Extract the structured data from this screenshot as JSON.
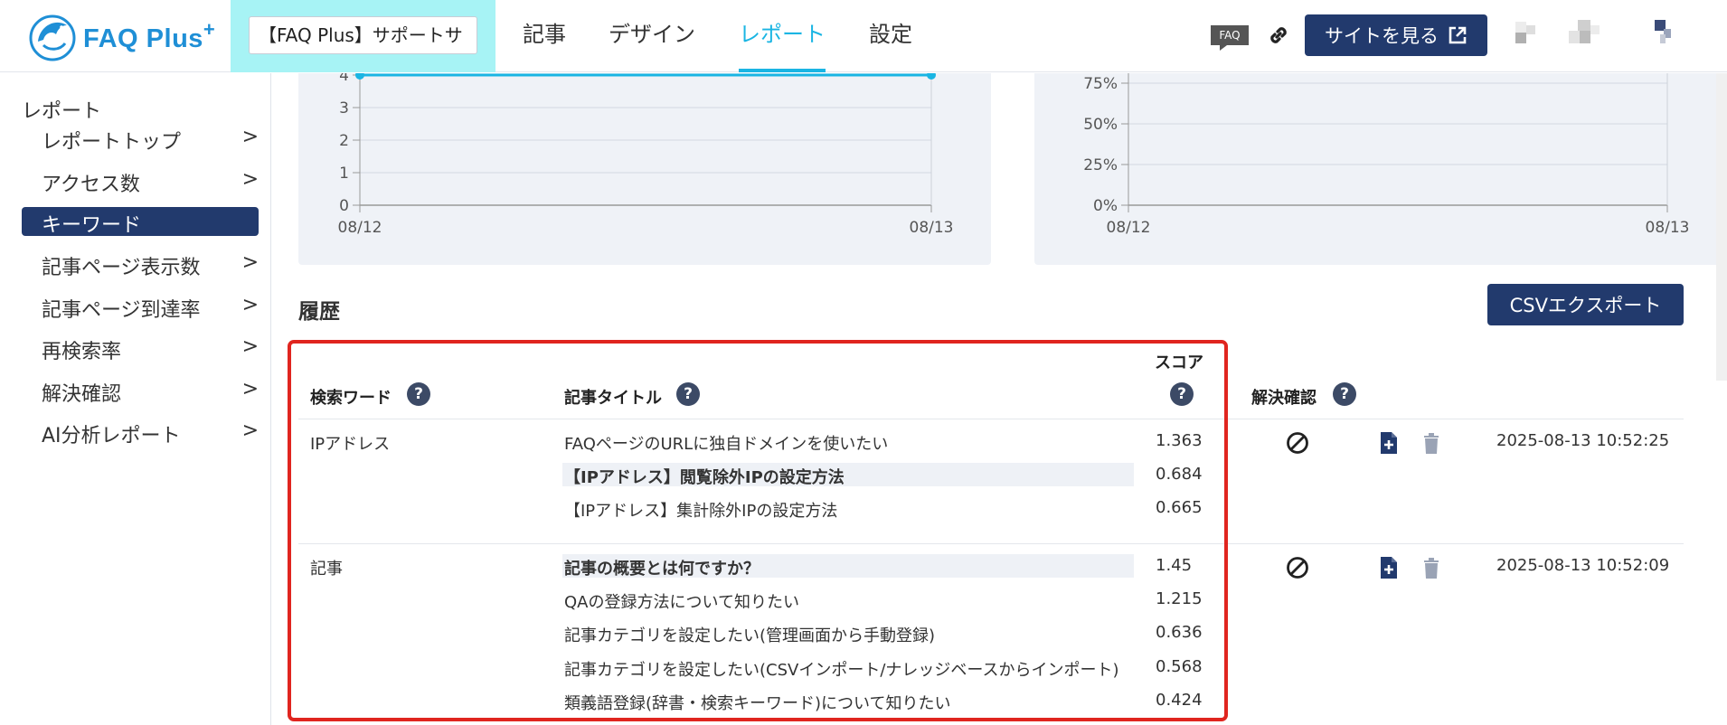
{
  "header": {
    "logo_text": "FAQ Plus",
    "logo_plus": "+",
    "site_selector_value": "【FAQ Plus】サポートサ",
    "nav_tabs": [
      {
        "label": "記事"
      },
      {
        "label": "デザイン"
      },
      {
        "label": "レポート",
        "active": true
      },
      {
        "label": "設定"
      }
    ],
    "faq_badge": "FAQ",
    "view_site_label": "サイトを見る"
  },
  "sidebar": {
    "title": "レポート",
    "items": [
      {
        "label": "レポートトップ",
        "chevron": ">"
      },
      {
        "label": "アクセス数",
        "chevron": ">"
      },
      {
        "label": "キーワード",
        "chevron": "",
        "active": true
      },
      {
        "label": "記事ページ表示数",
        "chevron": ">"
      },
      {
        "label": "記事ページ到達率",
        "chevron": ">"
      },
      {
        "label": "再検索率",
        "chevron": ">"
      },
      {
        "label": "解決確認",
        "chevron": ">"
      },
      {
        "label": "AI分析レポート",
        "chevron": ">"
      }
    ]
  },
  "chart_data": [
    {
      "type": "line",
      "x": [
        "08/12",
        "08/13"
      ],
      "y_ticks": [
        "0",
        "1",
        "2",
        "3",
        "4"
      ],
      "series": [
        {
          "values": [
            4,
            4
          ]
        }
      ],
      "grid": true
    },
    {
      "type": "line",
      "x": [
        "08/12",
        "08/13"
      ],
      "y_ticks": [
        "0%",
        "25%",
        "50%",
        "75%"
      ],
      "series": [],
      "grid": true
    }
  ],
  "history": {
    "title": "履歴",
    "csv_button": "CSVエクスポート",
    "columns": {
      "keyword": "検索ワード",
      "article_title": "記事タイトル",
      "score": "スコア",
      "resolution": "解決確認",
      "help": "?"
    },
    "rows": [
      {
        "keyword": "IPアドレス",
        "timestamp": "2025-08-13 10:52:25",
        "articles": [
          {
            "title": "FAQページのURLに独自ドメインを使いたい",
            "score": "1.363",
            "bold": false
          },
          {
            "title": "【IPアドレス】閲覧除外IPの設定方法",
            "score": "0.684",
            "bold": true
          },
          {
            "title": "【IPアドレス】集計除外IPの設定方法",
            "score": "0.665",
            "bold": false
          }
        ]
      },
      {
        "keyword": "記事",
        "timestamp": "2025-08-13 10:52:09",
        "articles": [
          {
            "title": "記事の概要とは何ですか？",
            "score": "1.45",
            "bold": true
          },
          {
            "title": "QAの登録方法について知りたい",
            "score": "1.215",
            "bold": false
          },
          {
            "title": "記事カテゴリを設定したい(管理画面から手動登録)",
            "score": "0.636",
            "bold": false
          },
          {
            "title": "記事カテゴリを設定したい(CSVインポート/ナレッジベースからインポート)",
            "score": "0.568",
            "bold": false
          },
          {
            "title": "類義語登録(辞書・検索キーワード)について知りたい",
            "score": "0.424",
            "bold": false
          }
        ]
      }
    ]
  },
  "colors": {
    "navy": "#223a6d",
    "accent": "#1ab5e3",
    "highlight_border": "#e0251f",
    "site_selector_bg": "#a7f3f5"
  }
}
